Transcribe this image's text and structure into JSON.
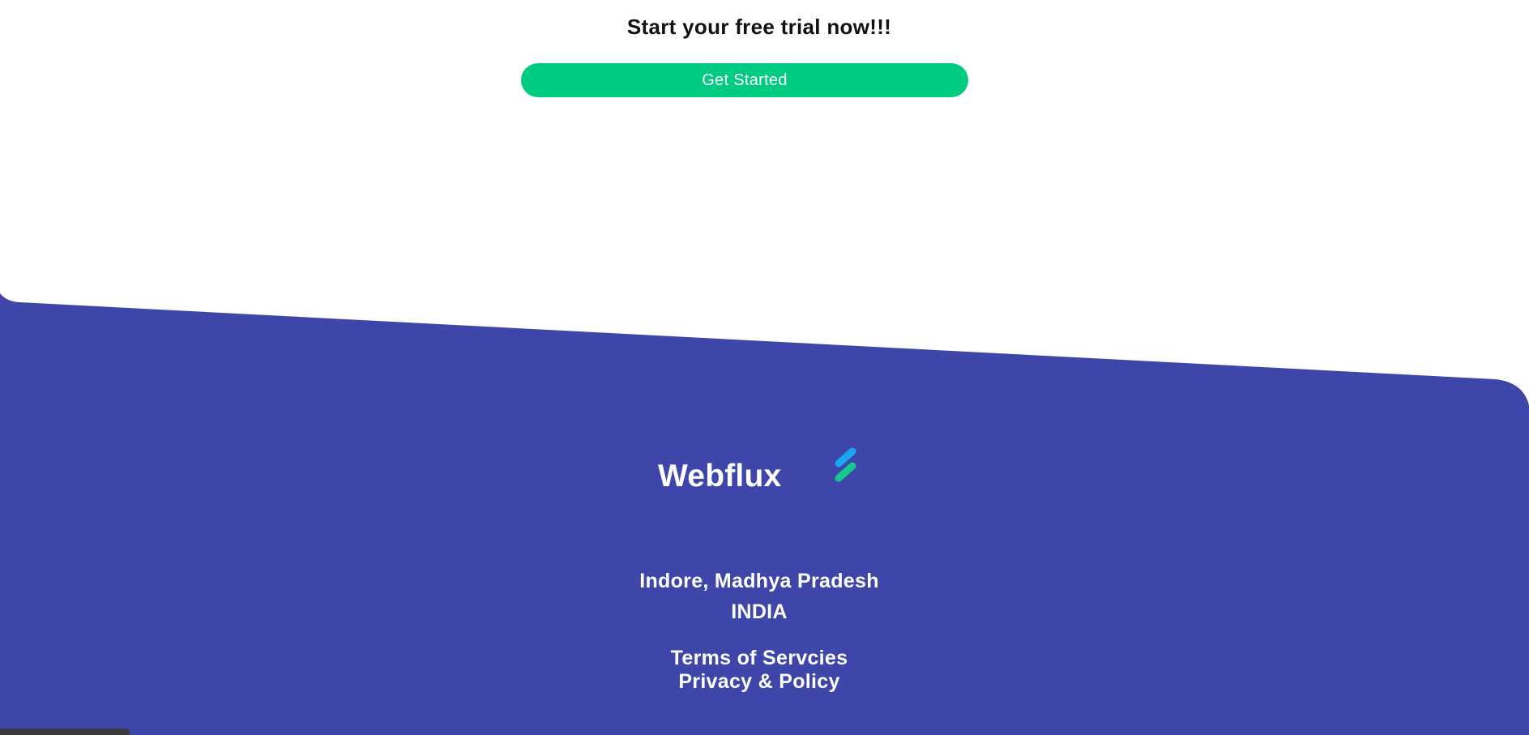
{
  "cta": {
    "title": "Start your free trial now!!!",
    "button_label": "Get Started"
  },
  "footer": {
    "brand": "Webflux",
    "logo_icon": "double-slash-logo-icon",
    "address_line_1": "Indore, Madhya Pradesh",
    "address_line_2": "INDIA",
    "links": [
      {
        "label": "Terms of Servcies"
      },
      {
        "label": "Privacy & Policy"
      }
    ]
  },
  "colors": {
    "accent": "#00cc81",
    "footer_bg": "#3e46a9",
    "logo_blue": "#1aa7f2",
    "logo_green": "#16c98a",
    "text_dark": "#111111"
  }
}
